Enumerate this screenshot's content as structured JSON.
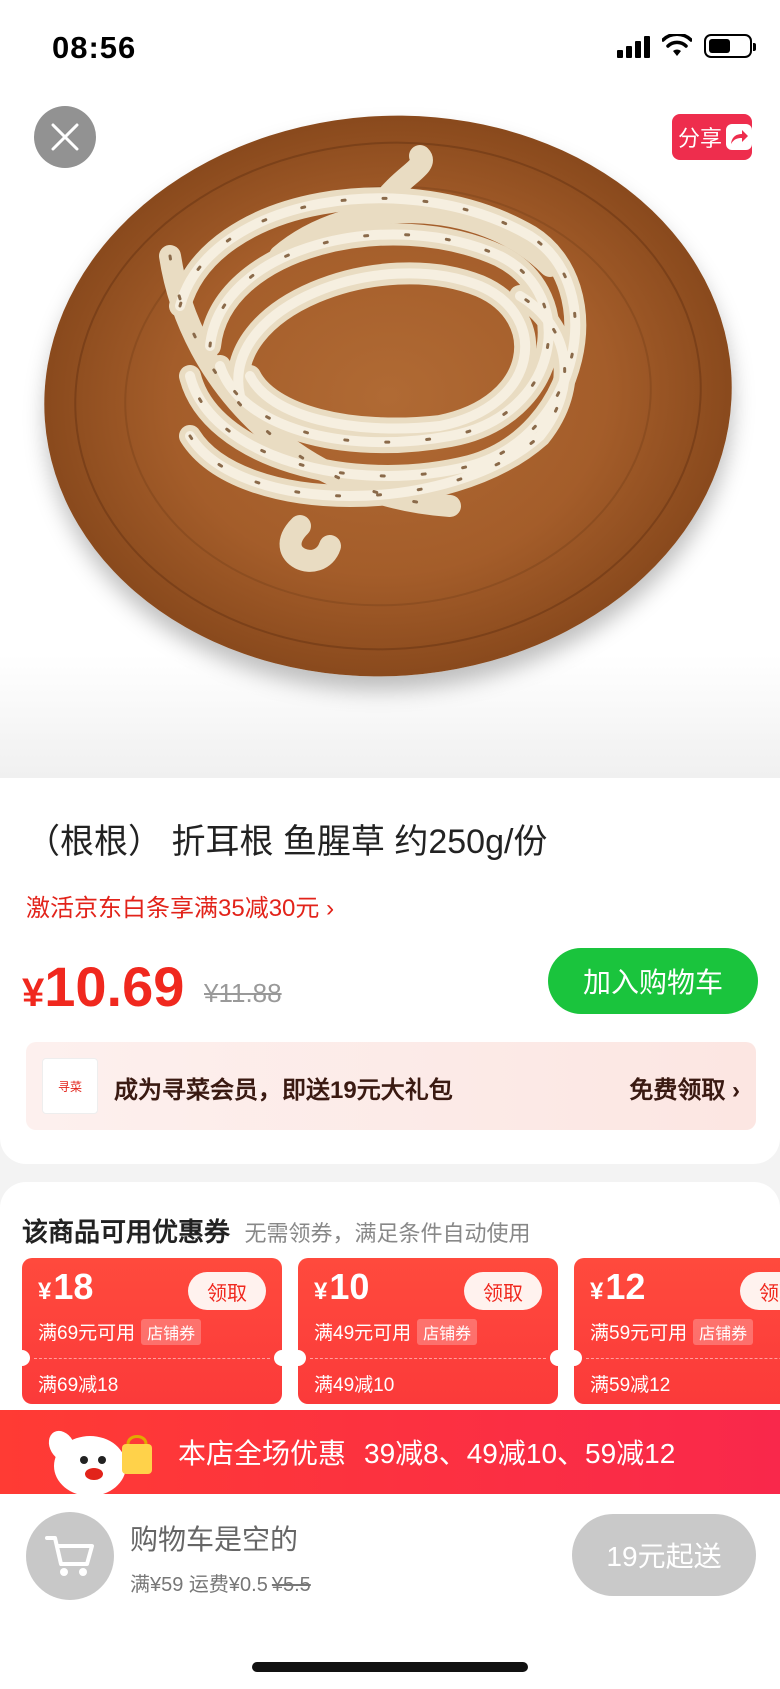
{
  "status_bar": {
    "time": "08:56",
    "signal_icon": "cellular-signal-icon",
    "wifi_icon": "wifi-icon",
    "battery_icon": "battery-icon"
  },
  "hero": {
    "close_icon": "close-icon",
    "share_label": "分享",
    "share_icon": "share-arrow-icon",
    "image": "wooden-plate-with-zheergen-roots"
  },
  "product": {
    "title": "（根根） 折耳根 鱼腥草 约250g/份",
    "promo": "激活京东白条享满35减30元",
    "price_currency": "¥",
    "price": "10.69",
    "original_price": "¥11.88",
    "add_to_cart": "加入购物车"
  },
  "membership": {
    "logo_text": "寻菜",
    "text": "成为寻菜会员，即送19元大礼包",
    "claim": "免费领取"
  },
  "coupons": {
    "heading": "该商品可用优惠券",
    "subheading": "无需领券，满足条件自动使用",
    "items": [
      {
        "currency": "¥",
        "amount": "18",
        "take": "领取",
        "condition": "满69元可用",
        "tag": "店铺券",
        "summary": "满69减18"
      },
      {
        "currency": "¥",
        "amount": "10",
        "take": "领取",
        "condition": "满49元可用",
        "tag": "店铺券",
        "summary": "满49减10"
      },
      {
        "currency": "¥",
        "amount": "12",
        "take": "领取",
        "condition": "满59元可用",
        "tag": "店铺券",
        "summary": "满59减12"
      }
    ]
  },
  "store_promo": {
    "label": "本店全场优惠",
    "rules": "39减8、49减10、59减12",
    "mascot_icon": "jd-dog-mascot-icon"
  },
  "cart": {
    "icon": "shopping-cart-icon",
    "empty_text": "购物车是空的",
    "fee_prefix": "满¥59 运费¥0.5",
    "fee_original": "¥5.5",
    "min_order": "19元起送"
  },
  "colors": {
    "price_red": "#f0281e",
    "cart_green": "#1ac43d",
    "share_red": "#ee2d4d",
    "banner_red": "#ff3b34"
  }
}
